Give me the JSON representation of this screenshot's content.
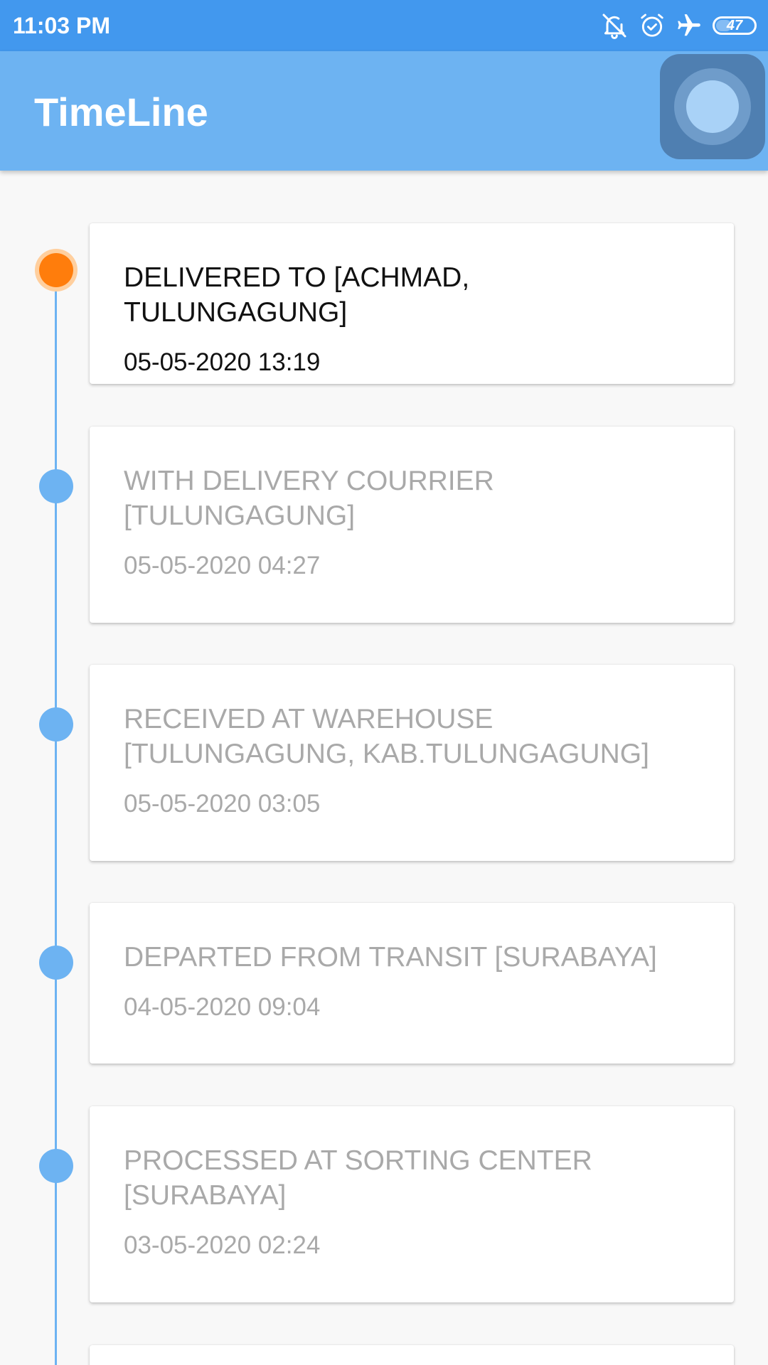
{
  "status_bar": {
    "time": "11:03 PM",
    "icons": [
      "notifications-off-icon",
      "alarm-icon",
      "airplane-icon",
      "battery-icon"
    ],
    "battery_level": "47",
    "background_color": "#4298ee"
  },
  "app_bar": {
    "title": "TimeLine",
    "background_color": "#6db3f2"
  },
  "timeline": {
    "line_color": "#6db3f2",
    "active_dot_color": "#ff7d0c",
    "events": [
      {
        "title": "DELIVERED TO [ACHMAD, TULUNGAGUNG]",
        "date": "05-05-2020 13:19",
        "active": true
      },
      {
        "title": "WITH DELIVERY COURRIER [TULUNGAGUNG]",
        "date": "05-05-2020 04:27",
        "active": false
      },
      {
        "title": "RECEIVED AT WAREHOUSE [TULUNGAGUNG, KAB.TULUNGAGUNG]",
        "date": "05-05-2020 03:05",
        "active": false
      },
      {
        "title": "DEPARTED FROM TRANSIT [SURABAYA]",
        "date": "04-05-2020 09:04",
        "active": false
      },
      {
        "title": "PROCESSED AT SORTING CENTER [SURABAYA]",
        "date": "03-05-2020 02:24",
        "active": false
      }
    ]
  }
}
